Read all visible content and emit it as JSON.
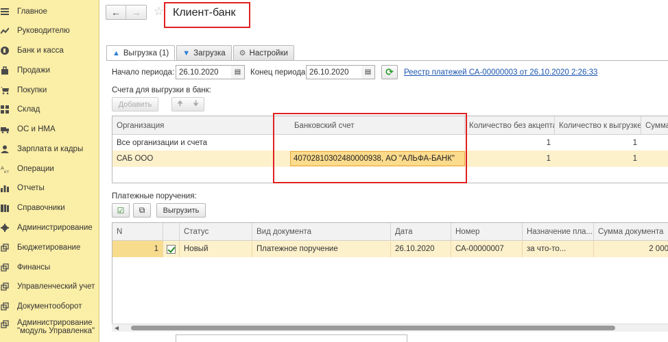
{
  "sidebar": {
    "items": [
      {
        "label": "Главное",
        "icon": "menu-lines-icon"
      },
      {
        "label": "Руководителю",
        "icon": "trend-chart-icon"
      },
      {
        "label": "Банк и касса",
        "icon": "coin-icon"
      },
      {
        "label": "Продажи",
        "icon": "shopping-bag-icon"
      },
      {
        "label": "Покупки",
        "icon": "cart-icon"
      },
      {
        "label": "Склад",
        "icon": "grid-icon"
      },
      {
        "label": "ОС и НМА",
        "icon": "truck-icon"
      },
      {
        "label": "Зарплата и кадры",
        "icon": "person-icon"
      },
      {
        "label": "Операции",
        "icon": "operations-icon"
      },
      {
        "label": "Отчеты",
        "icon": "bar-chart-icon"
      },
      {
        "label": "Справочники",
        "icon": "books-icon"
      },
      {
        "label": "Администрирование",
        "icon": "gear-icon"
      },
      {
        "label": "Бюджетирование",
        "icon": "link-out-icon"
      },
      {
        "label": "Финансы",
        "icon": "link-out-icon"
      },
      {
        "label": "Управленческий учет",
        "icon": "link-out-icon"
      },
      {
        "label": "Документооборот",
        "icon": "link-out-icon"
      },
      {
        "label": "Администрирование \"модуль Управленка\"",
        "icon": "link-out-icon"
      }
    ]
  },
  "header": {
    "title": "Клиент-банк"
  },
  "tabs": [
    {
      "label": "Выгрузка (1)",
      "icon": "upload-arrow-icon"
    },
    {
      "label": "Загрузка",
      "icon": "download-arrow-icon"
    },
    {
      "label": "Настройки",
      "icon": "settings-icon"
    }
  ],
  "period": {
    "start_label": "Начало периода:",
    "start_value": "26.10.2020",
    "end_label": "Конец периода:",
    "end_value": "26.10.2020",
    "registry_link": "Реестр платежей СА-00000003 от 26.10.2020 2:26:33"
  },
  "accounts": {
    "section_label": "Счета для выгрузки в банк:",
    "add_label": "Добавить",
    "columns": [
      "Организация",
      "Банковский счет",
      "Количество без акцепта",
      "Количество к выгрузке",
      "Сумма"
    ],
    "rows": [
      {
        "org": "Все организации и счета",
        "account": "",
        "no_accept": "1",
        "to_export": "1"
      },
      {
        "org": "САБ ООО",
        "account": "40702810302480000938, АО \"АЛЬФА-БАНК\"",
        "no_accept": "1",
        "to_export": "1"
      }
    ]
  },
  "payments": {
    "section_label": "Платежные поручения:",
    "export_label": "Выгрузить",
    "columns": [
      "N",
      "",
      "Статус",
      "Вид документа",
      "Дата",
      "Номер",
      "Назначение пла...",
      "Сумма документа"
    ],
    "rows": [
      {
        "n": "1",
        "status": "Новый",
        "doc_type": "Платежное поручение",
        "date": "26.10.2020",
        "number": "СА-00000007",
        "purpose": "за что-то...",
        "amount": "2 000"
      }
    ]
  }
}
